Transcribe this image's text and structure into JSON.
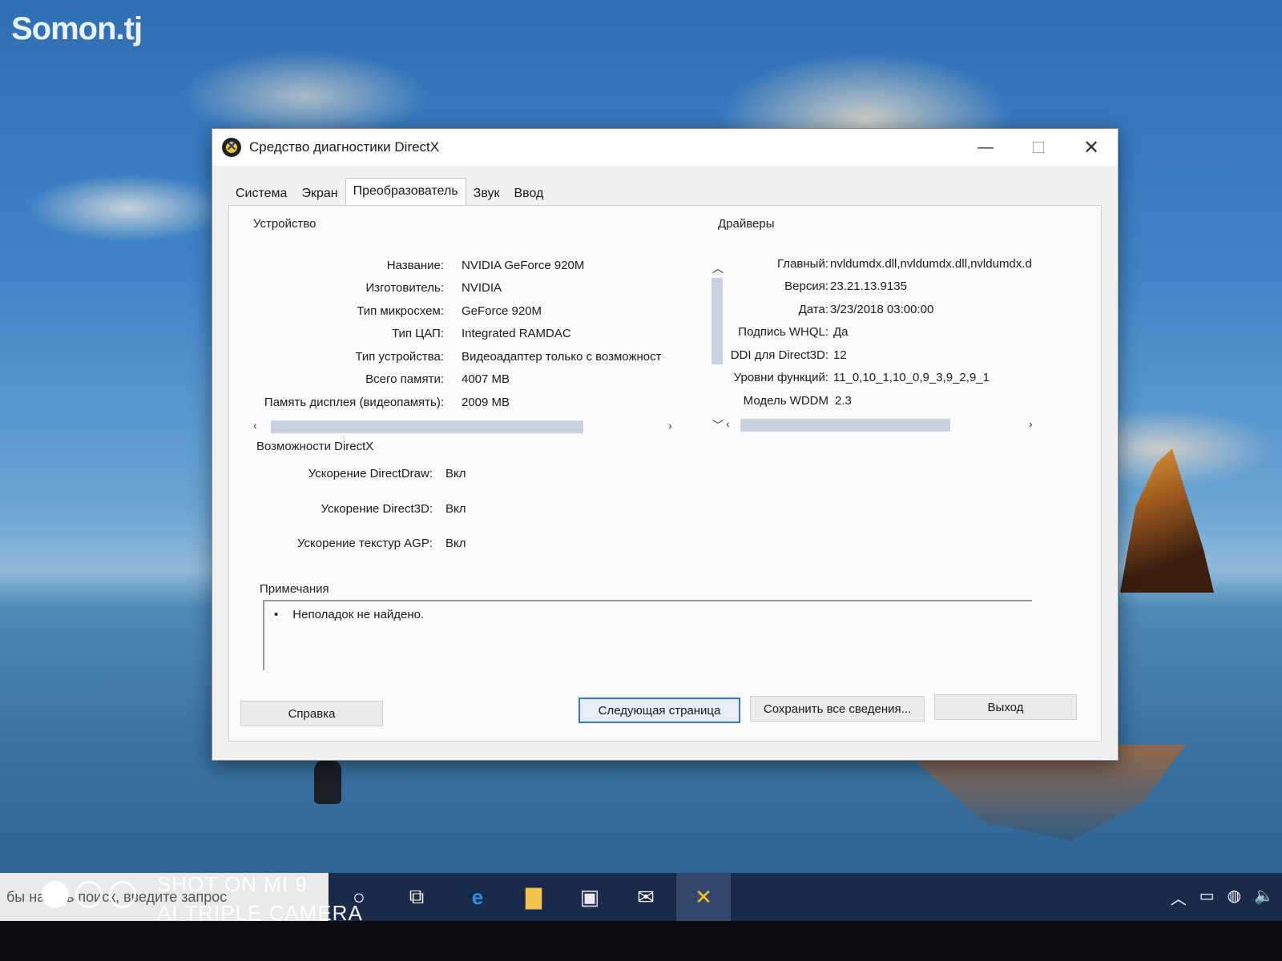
{
  "watermark": {
    "logo": "Somon.tj",
    "camera_line1": "SHOT ON MI 9",
    "camera_line2": "AI TRIPLE CAMERA"
  },
  "window": {
    "title": "Средство диагностики DirectX",
    "controls": {
      "minimize": "—",
      "close": "✕"
    }
  },
  "tabs": [
    {
      "label": "Система"
    },
    {
      "label": "Экран"
    },
    {
      "label": "Преобразователь",
      "active": true
    },
    {
      "label": "Звук"
    },
    {
      "label": "Ввод"
    }
  ],
  "device": {
    "group_label": "Устройство",
    "rows": [
      {
        "key": "Название:",
        "value": "NVIDIA GeForce 920M"
      },
      {
        "key": "Изготовитель:",
        "value": "NVIDIA"
      },
      {
        "key": "Тип микросхем:",
        "value": "GeForce 920M"
      },
      {
        "key": "Тип ЦАП:",
        "value": "Integrated RAMDAC"
      },
      {
        "key": "Тип устройства:",
        "value": "Видеоадаптер только с возможност"
      },
      {
        "key": "Всего памяти:",
        "value": "4007 MB"
      },
      {
        "key": "Память дисплея (видеопамять):",
        "value": "2009 MB"
      }
    ]
  },
  "drivers": {
    "group_label": "Драйверы",
    "rows": [
      {
        "key": "Главный:",
        "value": "nvldumdx.dll,nvldumdx.dll,nvldumdx.d"
      },
      {
        "key": "Версия:",
        "value": "23.21.13.9135"
      },
      {
        "key": "Дата:",
        "value": "3/23/2018 03:00:00"
      },
      {
        "key": "Подпись WHQL:",
        "value": "Да"
      },
      {
        "key": "DDI для Direct3D:",
        "value": "12"
      },
      {
        "key": "Уровни функций:",
        "value": "11_0,10_1,10_0,9_3,9_2,9_1"
      },
      {
        "key": "Модель WDDM",
        "value": "2.3"
      }
    ]
  },
  "directx_features": {
    "group_label": "Возможности DirectX",
    "rows": [
      {
        "key": "Ускорение DirectDraw:",
        "value": "Вкл"
      },
      {
        "key": "Ускорение Direct3D:",
        "value": "Вкл"
      },
      {
        "key": "Ускорение текстур AGP:",
        "value": "Вкл"
      }
    ]
  },
  "notes": {
    "group_label": "Примечания",
    "items": [
      "Неполадок не найдено."
    ]
  },
  "buttons": {
    "help": "Справка",
    "next_page": "Следующая страница",
    "save_all": "Сохранить все сведения...",
    "exit": "Выход"
  },
  "taskbar": {
    "search_placeholder": "бы начать поиск, введите запрос"
  }
}
